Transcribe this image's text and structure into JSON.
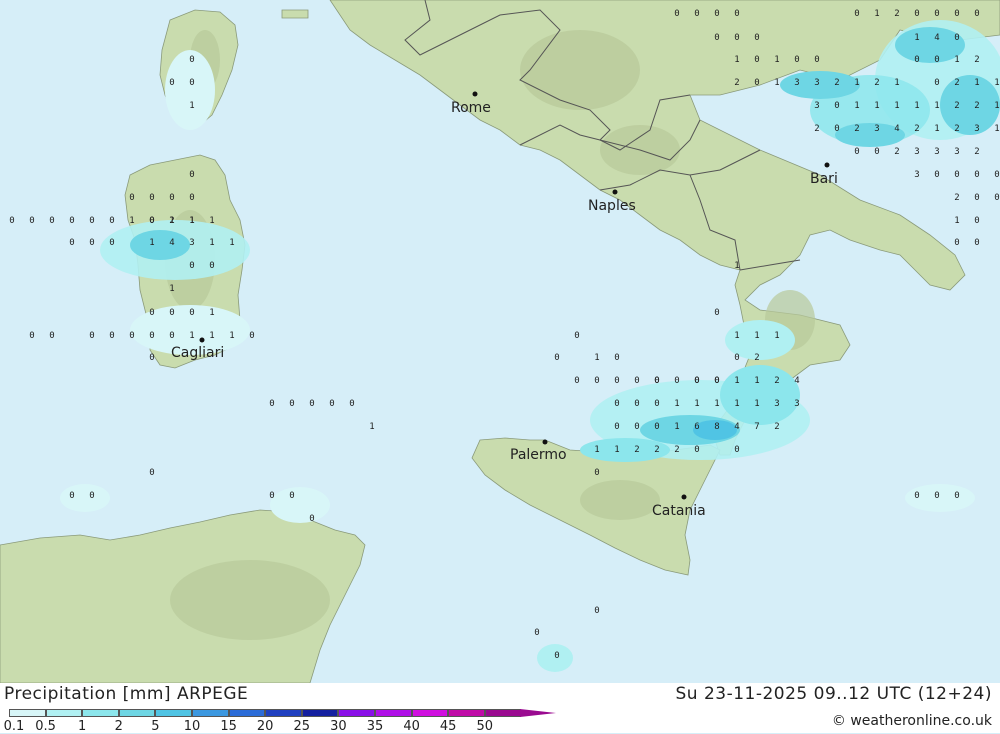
{
  "header": {
    "title": "Precipitation [mm] ARPEGE",
    "datetime": "Su 23-11-2025 09..12 UTC (12+24)",
    "credit": "© weatheronline.co.uk"
  },
  "legend": {
    "labels": [
      "0.1",
      "0.5",
      "1",
      "2",
      "5",
      "10",
      "15",
      "20",
      "25",
      "30",
      "35",
      "40",
      "45",
      "50"
    ],
    "colors": [
      "#d8f6f8",
      "#b0f0f2",
      "#8ce6ec",
      "#6ed6e4",
      "#50c4e4",
      "#3c98e0",
      "#2c6cd8",
      "#2040c0",
      "#1420a0",
      "#8a10e8",
      "#b010e8",
      "#d010e0",
      "#c00ca8",
      "#9a0a90"
    ]
  },
  "cities": [
    {
      "name": "Rome",
      "marker": "dot"
    },
    {
      "name": "Naples",
      "marker": "dot"
    },
    {
      "name": "Bari",
      "marker": "dot"
    },
    {
      "name": "Cagliari",
      "marker": "dot"
    },
    {
      "name": "Palermo",
      "marker": "dot"
    },
    {
      "name": "Catania",
      "marker": "dot"
    }
  ],
  "precip_values": [
    "0",
    "0",
    "0",
    "0",
    "0",
    "1",
    "2",
    "0",
    "0",
    "0",
    "0",
    "0",
    "0",
    "0",
    "1",
    "4",
    "0",
    "1",
    "0",
    "1",
    "0",
    "0",
    "0",
    "0",
    "1",
    "2",
    "2",
    "0",
    "1",
    "3",
    "3",
    "2",
    "1",
    "2",
    "1",
    "0",
    "2",
    "1",
    "1",
    "3",
    "0",
    "1",
    "1",
    "1",
    "1",
    "1",
    "2",
    "2",
    "1",
    "2",
    "0",
    "2",
    "3",
    "4",
    "2",
    "1",
    "2",
    "3",
    "1",
    "0",
    "0",
    "2",
    "3",
    "3",
    "3",
    "2",
    "3",
    "0",
    "0",
    "0",
    "0",
    "2",
    "0",
    "0",
    "1",
    "0",
    "0",
    "0",
    "0",
    "0",
    "0",
    "1",
    "0",
    "0",
    "0",
    "0",
    "0",
    "1",
    "0",
    "1",
    "1",
    "0",
    "0",
    "0",
    "0",
    "0",
    "0",
    "0",
    "2",
    "1",
    "1",
    "0",
    "0",
    "0",
    "1",
    "4",
    "3",
    "1",
    "1",
    "0",
    "0",
    "1",
    "0",
    "0",
    "0",
    "0",
    "0",
    "0",
    "0",
    "1",
    "1",
    "1",
    "0",
    "0",
    "0",
    "0",
    "1",
    "0",
    "1",
    "0",
    "1",
    "1",
    "1",
    "0",
    "0",
    "0",
    "0",
    "0",
    "0",
    "0",
    "2",
    "0",
    "0",
    "0",
    "0",
    "0",
    "0",
    "0",
    "0",
    "1",
    "1",
    "2",
    "4",
    "1",
    "0",
    "0",
    "0",
    "0",
    "0",
    "0",
    "0",
    "0",
    "1",
    "1",
    "1",
    "1",
    "1",
    "3",
    "3",
    "1",
    "0",
    "0",
    "0",
    "1",
    "6",
    "8",
    "4",
    "7",
    "2",
    "1",
    "1",
    "2",
    "2",
    "2",
    "0",
    "0",
    "0",
    "0",
    "0",
    "0",
    "0",
    "0",
    "0",
    "0",
    "0",
    "0",
    "0",
    "0",
    "0",
    "1"
  ]
}
